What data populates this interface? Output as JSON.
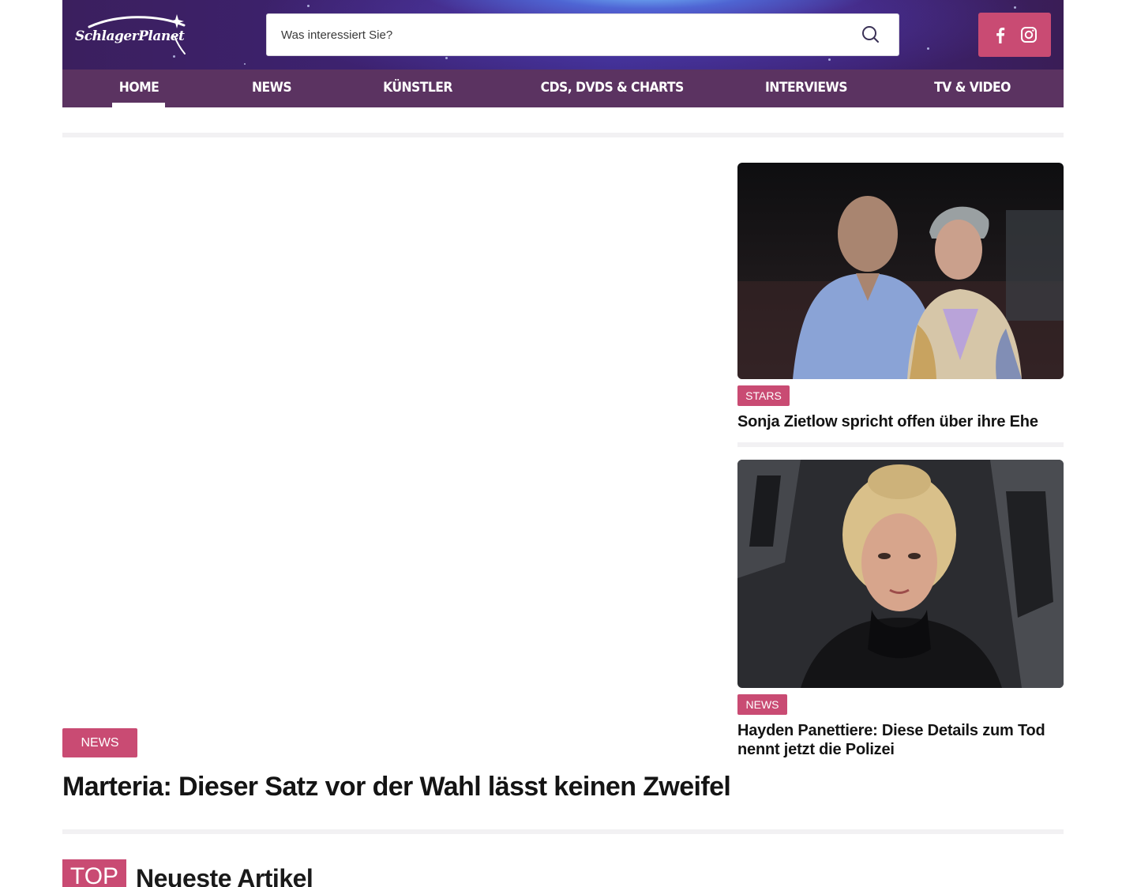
{
  "header": {
    "logo_text": "SchlagerPlanet",
    "search": {
      "placeholder": "Was interessiert Sie?",
      "value": ""
    },
    "social": {
      "facebook_icon": "facebook-icon",
      "instagram_icon": "instagram-icon"
    }
  },
  "nav": {
    "items": [
      {
        "label": "HOME",
        "active": true
      },
      {
        "label": "NEWS",
        "active": false
      },
      {
        "label": "KÜNSTLER",
        "active": false
      },
      {
        "label": "CDS, DVDS & CHARTS",
        "active": false
      },
      {
        "label": "INTERVIEWS",
        "active": false
      },
      {
        "label": "TV & VIDEO",
        "active": false
      }
    ]
  },
  "hero": {
    "category": "NEWS",
    "title": "Marteria: Dieser Satz vor der Wahl lässt keinen Zweifel"
  },
  "side_articles": [
    {
      "category": "STARS",
      "title": "Sonja Zietlow spricht offen über ihre Ehe"
    },
    {
      "category": "NEWS",
      "title": "Hayden Panettiere: Diese Details zum Tod nennt jetzt die Polizei"
    }
  ],
  "section": {
    "tag": "TOP",
    "title": "Neueste Artikel"
  },
  "colors": {
    "accent": "#c94b73",
    "nav_background": "#5b3361",
    "header_background": "#3c2270",
    "divider": "#f2f1f3"
  }
}
